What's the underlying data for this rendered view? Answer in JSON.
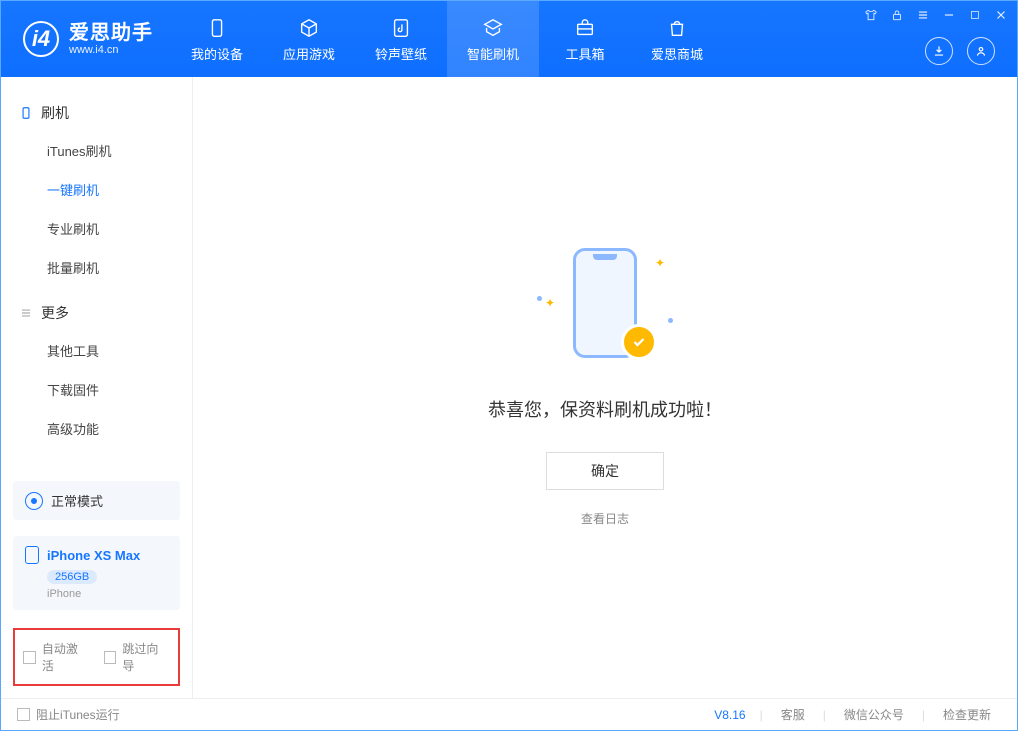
{
  "colors": {
    "primary": "#1776ff",
    "accent": "#ffb900",
    "highlight_border": "#e83b3b"
  },
  "logo": {
    "title": "爱思助手",
    "subtitle": "www.i4.cn"
  },
  "nav": [
    {
      "label": "我的设备",
      "icon": "device-icon"
    },
    {
      "label": "应用游戏",
      "icon": "cube-icon"
    },
    {
      "label": "铃声壁纸",
      "icon": "music-icon"
    },
    {
      "label": "智能刷机",
      "icon": "refresh-icon",
      "active": true
    },
    {
      "label": "工具箱",
      "icon": "toolbox-icon"
    },
    {
      "label": "爱思商城",
      "icon": "bag-icon"
    }
  ],
  "sidebar": {
    "section1": {
      "title": "刷机",
      "items": [
        {
          "label": "iTunes刷机"
        },
        {
          "label": "一键刷机",
          "active": true
        },
        {
          "label": "专业刷机"
        },
        {
          "label": "批量刷机"
        }
      ]
    },
    "section2": {
      "title": "更多",
      "items": [
        {
          "label": "其他工具"
        },
        {
          "label": "下载固件"
        },
        {
          "label": "高级功能"
        }
      ]
    }
  },
  "mode": {
    "label": "正常模式"
  },
  "device": {
    "name": "iPhone XS Max",
    "capacity": "256GB",
    "type": "iPhone"
  },
  "options": {
    "auto_activate": "自动激活",
    "skip_guide": "跳过向导"
  },
  "main": {
    "success_text": "恭喜您，保资料刷机成功啦！",
    "ok_button": "确定",
    "log_link": "查看日志"
  },
  "footer": {
    "block_itunes": "阻止iTunes运行",
    "version": "V8.16",
    "links": [
      "客服",
      "微信公众号",
      "检查更新"
    ]
  }
}
